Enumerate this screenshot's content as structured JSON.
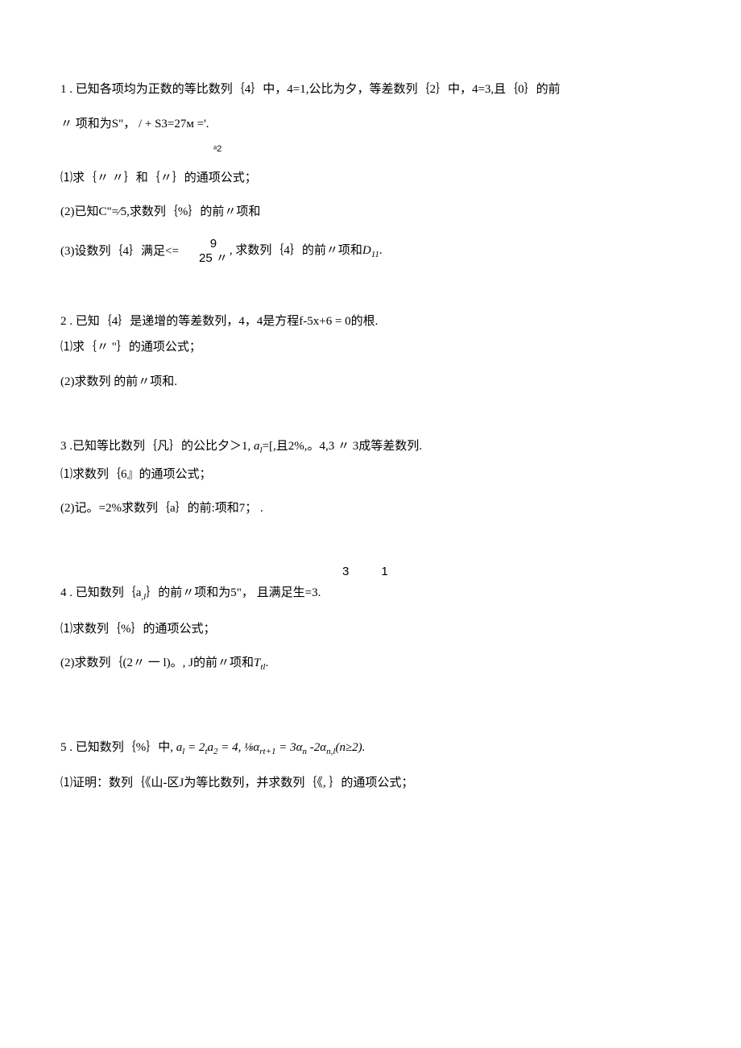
{
  "p1": {
    "l1": "1 . 已知各项均为正数的等比数列｛4｝中，4=1,公比为夕，等差数列｛2｝中，4=3,且｛0｝的前",
    "l2a": "〃 项和为S\"，  / + S3=27м ='.",
    "l2b": "ᵃ2",
    "l3": "⑴求｛〃 〃｝和｛〃｝的通项公式；",
    "l4": "(2)已知C\"=∕5,求数列｛%｝的前〃项和",
    "l5_frac_top": "9",
    "l5_text_a": "(3)设数列｛4｝满足<=一, 求数列｛4｝的前〃项和",
    "l5_d": "D",
    "l5_dsub": "11",
    "l5_dot": ".",
    "l5_frac_bot": "25 〃"
  },
  "p2": {
    "l1": "2  . 已知｛4｝是递增的等差数列，4，4是方程f-5x+6 = 0的根.",
    "l2": "⑴求｛〃 \"｝的通项公式；",
    "l3": "(2)求数列 的前〃项和."
  },
  "p3": {
    "l1a": "3  .已知等比数列｛凡｝的公比夕＞1, ",
    "l1_ai": "a",
    "l1_sub": "l",
    "l1b": "=[,且2%,。4,3 〃 3成等差数列.",
    "l2": "⑴求数列｛6』的通项公式；",
    "l3a": "(2)记。=2%求数列｛a｝的前:项和7；",
    "l3b": " ."
  },
  "p4": {
    "top_a": "3",
    "top_b": "1",
    "l1a": "4  . 已知数列｛a",
    "l1_sub": ",l",
    "l1b": "｝的前〃项和为5\"， 且满足生=3.",
    "l2": "⑴求数列｛%｝的通项公式；",
    "l3a": "(2)求数列｛(2〃 一 l)。, J的前〃项和",
    "l3_T": "T",
    "l3_Tsub": "tl",
    "l3_dot": "."
  },
  "p5": {
    "l1a": "5  . 已知数列｛%｝中, ",
    "l1_ai": "a",
    "l1_sub1": "l",
    "l1_eq1": " = 2",
    "l1_t": "t",
    "l1_a2": "a",
    "l1_sub2": "2",
    "l1_eq2": " = 4, ⅛α",
    "l1_sub3": "rt+1",
    "l1_mid": " = 3α",
    "l1_sub4": "n",
    "l1_mid2": " -2α",
    "l1_sub5": "n,l",
    "l1_end": "(n≥2).",
    "l2": "⑴证明：数列｛《山-区J为等比数列，并求数列｛《, ｝的通项公式；"
  }
}
